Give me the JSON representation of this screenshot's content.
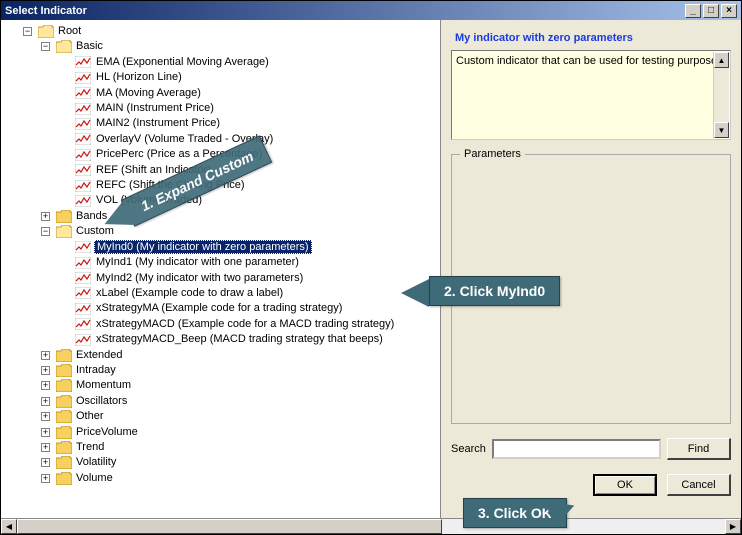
{
  "window": {
    "title": "Select Indicator"
  },
  "tree": {
    "root": "Root",
    "basic": "Basic",
    "basic_items": [
      "EMA (Exponential Moving Average)",
      "HL (Horizon Line)",
      "MA (Moving Average)",
      "MAIN (Instrument Price)",
      "MAIN2 (Instrument Price)",
      "OverlayV (Volume Traded - Overlay)",
      "PricePerc (Price as a Percentage)",
      "REF (Shift an Indicator)",
      "REFC (Shift the Closing Price)",
      "VOL (Volume Traded)"
    ],
    "bands": "Bands",
    "custom": "Custom",
    "custom_items": [
      "MyInd0 (My indicator with zero parameters)",
      "MyInd1 (My indicator with one parameter)",
      "MyInd2 (My indicator with two parameters)",
      "xLabel (Example code to draw a label)",
      "xStrategyMA (Example code for a trading strategy)",
      "xStrategyMACD (Example code for a MACD trading strategy)",
      "xStrategyMACD_Beep (MACD trading strategy that beeps)"
    ],
    "selected_custom_index": 0,
    "folders": [
      "Extended",
      "Intraday",
      "Momentum",
      "Oscillators",
      "Other",
      "PriceVolume",
      "Trend",
      "Volatility",
      "Volume"
    ]
  },
  "details": {
    "heading": "My indicator with zero parameters",
    "description": "Custom indicator that can be used for testing purposes.",
    "parameters_label": "Parameters"
  },
  "search": {
    "label": "Search",
    "value": "",
    "find_label": "Find"
  },
  "buttons": {
    "ok": "OK",
    "cancel": "Cancel"
  },
  "callouts": {
    "expand": "1. Expand Custom",
    "click_item": "2. Click MyInd0",
    "click_ok": "3. Click OK"
  }
}
